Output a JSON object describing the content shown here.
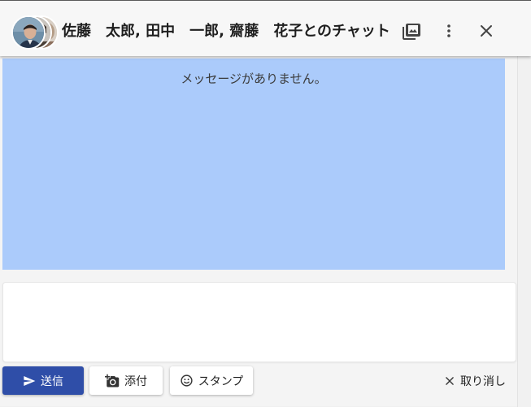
{
  "header": {
    "title": "佐藤　太郎, 田中　一郎, 齋藤　花子とのチャット",
    "avatars": [
      "avatar-1",
      "avatar-2",
      "avatar-3"
    ],
    "icons": [
      "gallery-icon",
      "more-vert-icon",
      "close-icon"
    ]
  },
  "messages": {
    "empty_text": "メッセージがありません。",
    "background_color": "#abcbfb"
  },
  "composer": {
    "value": "",
    "placeholder": ""
  },
  "actions": {
    "send_label": "送信",
    "attach_label": "添付",
    "stamp_label": "スタンプ",
    "cancel_label": "取り消し"
  },
  "colors": {
    "send_button": "#2f4ea8"
  }
}
